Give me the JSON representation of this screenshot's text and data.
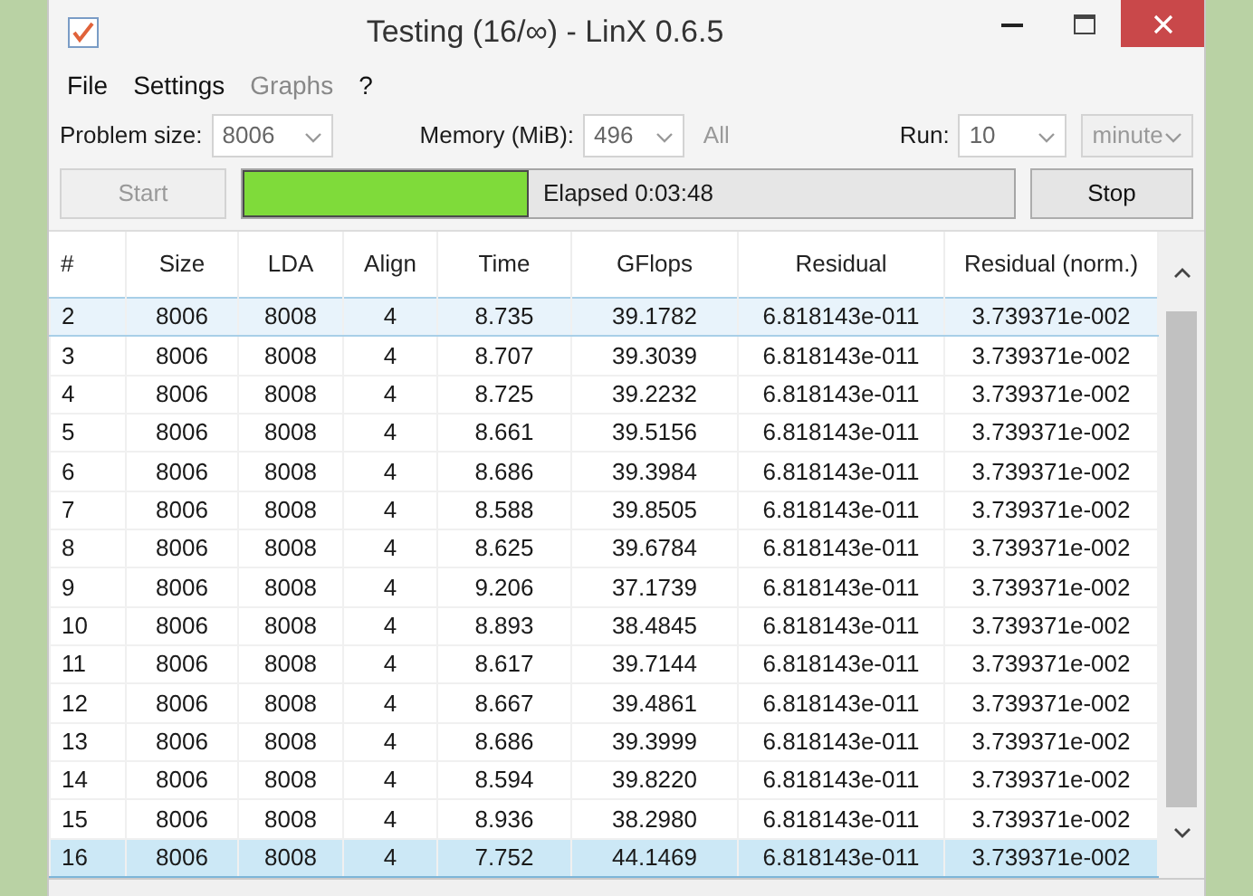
{
  "window": {
    "title": "Testing (16/∞) - LinX 0.6.5"
  },
  "menu": [
    {
      "label": "File",
      "disabled": false
    },
    {
      "label": "Settings",
      "disabled": false
    },
    {
      "label": "Graphs",
      "disabled": true
    },
    {
      "label": "?",
      "disabled": false
    }
  ],
  "settings": [
    {
      "label": "Problem size:",
      "value": "8006",
      "disabled": false
    },
    {
      "label": "Memory (MiB):",
      "value": "496",
      "disabled": false,
      "note": "All"
    },
    {
      "label": "Run:",
      "value": "10",
      "disabled": false
    },
    {
      "value": "minute",
      "disabled": true
    }
  ],
  "start_button": {
    "label": "Start",
    "disabled": true
  },
  "progress": {
    "level": 0.37,
    "text": "Elapsed 0:03:48"
  },
  "stop_button": {
    "label": "Stop",
    "disabled": false
  },
  "table": {
    "columns": [
      "#",
      "Size",
      "LDA",
      "Align",
      "Time",
      "GFlops",
      "Residual",
      "Residual (norm.)"
    ],
    "rows": [
      {
        "cells": [
          "2",
          "8006",
          "8008",
          "4",
          "8.735",
          "39.1782",
          "6.818143e-011",
          "3.739371e-002"
        ],
        "selected": false,
        "hovered": true
      },
      {
        "cells": [
          "3",
          "8006",
          "8008",
          "4",
          "8.707",
          "39.3039",
          "6.818143e-011",
          "3.739371e-002"
        ],
        "selected": false,
        "hovered": false
      },
      {
        "cells": [
          "4",
          "8006",
          "8008",
          "4",
          "8.725",
          "39.2232",
          "6.818143e-011",
          "3.739371e-002"
        ],
        "selected": false,
        "hovered": false
      },
      {
        "cells": [
          "5",
          "8006",
          "8008",
          "4",
          "8.661",
          "39.5156",
          "6.818143e-011",
          "3.739371e-002"
        ],
        "selected": false,
        "hovered": false
      },
      {
        "cells": [
          "6",
          "8006",
          "8008",
          "4",
          "8.686",
          "39.3984",
          "6.818143e-011",
          "3.739371e-002"
        ],
        "selected": false,
        "hovered": false
      },
      {
        "cells": [
          "7",
          "8006",
          "8008",
          "4",
          "8.588",
          "39.8505",
          "6.818143e-011",
          "3.739371e-002"
        ],
        "selected": false,
        "hovered": false
      },
      {
        "cells": [
          "8",
          "8006",
          "8008",
          "4",
          "8.625",
          "39.6784",
          "6.818143e-011",
          "3.739371e-002"
        ],
        "selected": false,
        "hovered": false
      },
      {
        "cells": [
          "9",
          "8006",
          "8008",
          "4",
          "9.206",
          "37.1739",
          "6.818143e-011",
          "3.739371e-002"
        ],
        "selected": false,
        "hovered": false
      },
      {
        "cells": [
          "10",
          "8006",
          "8008",
          "4",
          "8.893",
          "38.4845",
          "6.818143e-011",
          "3.739371e-002"
        ],
        "selected": false,
        "hovered": false
      },
      {
        "cells": [
          "11",
          "8006",
          "8008",
          "4",
          "8.617",
          "39.7144",
          "6.818143e-011",
          "3.739371e-002"
        ],
        "selected": false,
        "hovered": false
      },
      {
        "cells": [
          "12",
          "8006",
          "8008",
          "4",
          "8.667",
          "39.4861",
          "6.818143e-011",
          "3.739371e-002"
        ],
        "selected": false,
        "hovered": false
      },
      {
        "cells": [
          "13",
          "8006",
          "8008",
          "4",
          "8.686",
          "39.3999",
          "6.818143e-011",
          "3.739371e-002"
        ],
        "selected": false,
        "hovered": false
      },
      {
        "cells": [
          "14",
          "8006",
          "8008",
          "4",
          "8.594",
          "39.8220",
          "6.818143e-011",
          "3.739371e-002"
        ],
        "selected": false,
        "hovered": false
      },
      {
        "cells": [
          "15",
          "8006",
          "8008",
          "4",
          "8.936",
          "38.2980",
          "6.818143e-011",
          "3.739371e-002"
        ],
        "selected": false,
        "hovered": false
      },
      {
        "cells": [
          "16",
          "8006",
          "8008",
          "4",
          "7.752",
          "44.1469",
          "6.818143e-011",
          "3.739371e-002"
        ],
        "selected": true,
        "hovered": false
      }
    ]
  }
}
